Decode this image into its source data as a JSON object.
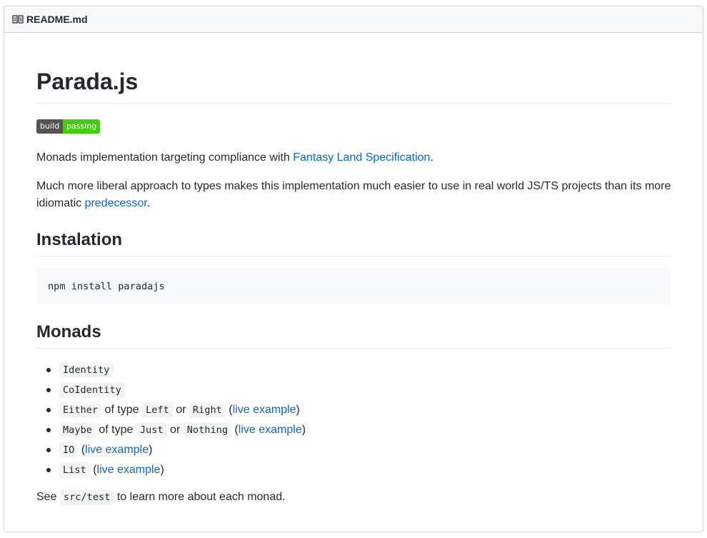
{
  "header": {
    "icon": "book-icon",
    "filename": "README.md"
  },
  "title": "Parada.js",
  "badge": {
    "label": "build",
    "status": "passing",
    "label_color": "#555555",
    "status_color": "#44cc11"
  },
  "intro": {
    "text_before": "Monads implementation targeting compliance with ",
    "link": "Fantasy Land Specification",
    "text_after": "."
  },
  "liberal": {
    "text_before": "Much more liberal approach to types makes this implementation much easier to use in real world JS/TS projects than its more idiomatic ",
    "link": "predecessor",
    "text_after": "."
  },
  "installation": {
    "heading": "Instalation",
    "command": "npm install paradajs"
  },
  "monads": {
    "heading": "Monads",
    "identity": "Identity",
    "coidentity": "CoIdentity",
    "either": {
      "name": "Either",
      "of_type": " of type ",
      "left": "Left",
      "or": " or ",
      "right": "Right",
      "open": " (",
      "link": "live example",
      "close": ")"
    },
    "maybe": {
      "name": "Maybe",
      "of_type": " of type ",
      "just": "Just",
      "or": " or ",
      "nothing": "Nothing",
      "open": " (",
      "link": "live example",
      "close": ")"
    },
    "io": {
      "name": "IO",
      "open": " (",
      "link": "live example",
      "close": ")"
    },
    "list": {
      "name": "List",
      "open": " (",
      "link": "live example",
      "close": ")"
    }
  },
  "footer": {
    "text_before": "See ",
    "code": "src/test",
    "text_after": " to learn more about each monad."
  }
}
